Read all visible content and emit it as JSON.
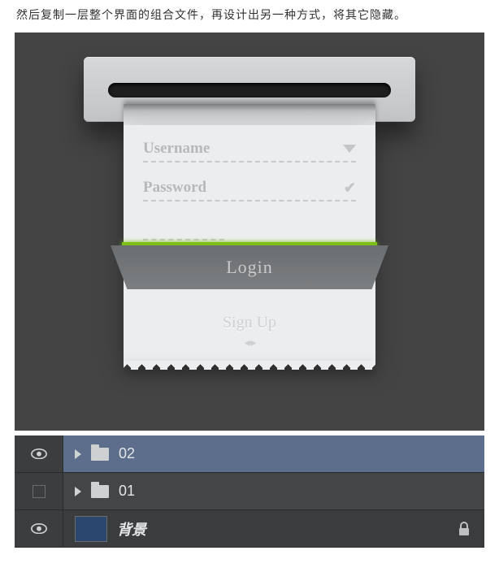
{
  "caption": "然后复制一层整个界面的组合文件，再设计出另一种方式，将其它隐藏。",
  "form": {
    "username_label": "Username",
    "password_label": "Password",
    "login_label": "Login",
    "signup_label": "Sign Up"
  },
  "layers": {
    "items": [
      {
        "name": "02",
        "visible": true,
        "type": "group",
        "selected": true
      },
      {
        "name": "01",
        "visible": false,
        "type": "group",
        "selected": false
      },
      {
        "name": "背景",
        "visible": true,
        "type": "layer",
        "locked": true
      }
    ]
  }
}
